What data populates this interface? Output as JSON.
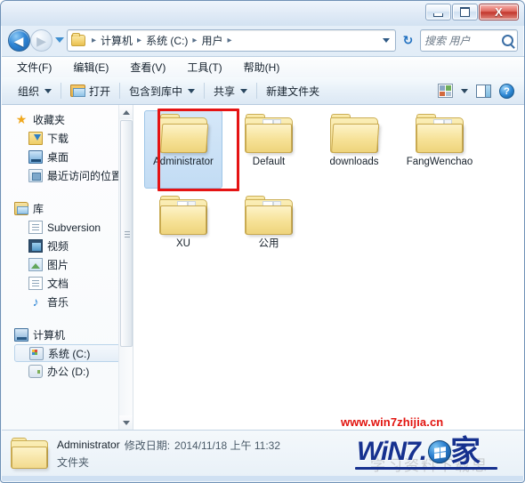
{
  "window": {
    "buttons": {
      "minimize": "–",
      "maximize": "□",
      "close": "X"
    }
  },
  "address": {
    "back_arrow": "◀",
    "forward_arrow": "▶",
    "crumbs": [
      "计算机",
      "系统 (C:)",
      "用户"
    ],
    "separator": "▸",
    "refresh": "↻"
  },
  "search": {
    "placeholder": "搜索 用户"
  },
  "menubar": {
    "items": [
      "文件(F)",
      "编辑(E)",
      "查看(V)",
      "工具(T)",
      "帮助(H)"
    ]
  },
  "toolbar": {
    "organize": "组织",
    "open": "打开",
    "include_in_library": "包含到库中",
    "share": "共享",
    "new_folder": "新建文件夹",
    "help": "?"
  },
  "sidebar": {
    "groups": [
      {
        "header": {
          "label": "收藏夹",
          "icon": "star-icon"
        },
        "items": [
          {
            "label": "下载",
            "icon": "downloads-icon"
          },
          {
            "label": "桌面",
            "icon": "desktop-icon"
          },
          {
            "label": "最近访问的位置",
            "icon": "recent-places-icon"
          }
        ]
      },
      {
        "header": {
          "label": "库",
          "icon": "library-icon"
        },
        "items": [
          {
            "label": "Subversion",
            "icon": "document-icon"
          },
          {
            "label": "视频",
            "icon": "video-icon"
          },
          {
            "label": "图片",
            "icon": "picture-icon"
          },
          {
            "label": "文档",
            "icon": "document-icon"
          },
          {
            "label": "音乐",
            "icon": "music-icon"
          }
        ]
      },
      {
        "header": {
          "label": "计算机",
          "icon": "computer-icon"
        },
        "items": [
          {
            "label": "系统 (C:)",
            "icon": "system-drive-icon",
            "selected": true
          },
          {
            "label": "办公 (D:)",
            "icon": "drive-icon"
          }
        ]
      }
    ]
  },
  "files": [
    {
      "name": "Administrator",
      "selected": true,
      "highlighted": true,
      "icon": "folder-open-icon"
    },
    {
      "name": "Default",
      "selected": false,
      "highlighted": false,
      "icon": "folder-icon"
    },
    {
      "name": "downloads",
      "selected": false,
      "highlighted": false,
      "icon": "folder-open-icon"
    },
    {
      "name": "FangWenchao",
      "selected": false,
      "highlighted": false,
      "icon": "folder-icon"
    },
    {
      "name": "XU",
      "selected": false,
      "highlighted": false,
      "icon": "folder-icon"
    },
    {
      "name": "公用",
      "selected": false,
      "highlighted": false,
      "icon": "folder-icon"
    }
  ],
  "details": {
    "name": "Administrator",
    "date_label": "修改日期:",
    "date_value": "2014/11/18 上午 11:32",
    "type": "文件夹"
  },
  "watermark": {
    "url": "www.win7zhijia.cn",
    "brand_text": "WiN7.",
    "brand_char": "家",
    "ghost_text": "学习资料下载思"
  },
  "colors": {
    "accent": "#2b7fd0",
    "highlight_box": "#e51313",
    "selection": "#c2dcf4",
    "watermark_red": "#e2140f",
    "watermark_blue": "#16318f"
  }
}
